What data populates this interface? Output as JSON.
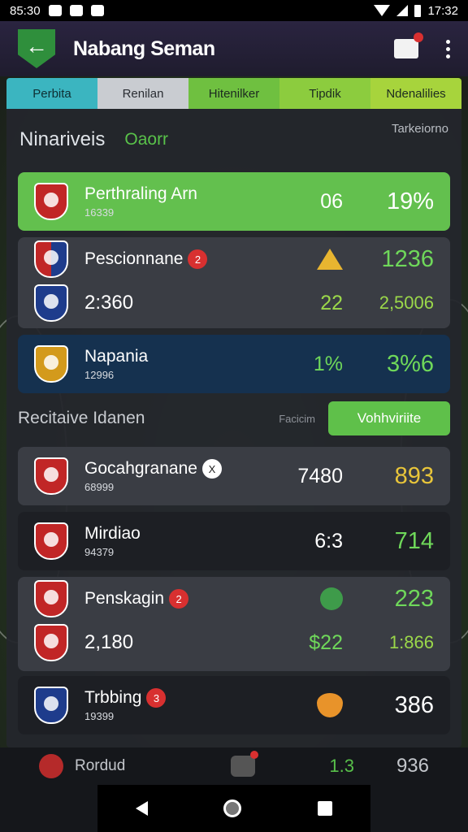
{
  "status_bar": {
    "time_left": "85:30",
    "time_right": "17:32"
  },
  "app_bar": {
    "title": "Nabang Seman"
  },
  "tabs": [
    "Perbita",
    "Renilan",
    "Hitenilker",
    "Tipdik",
    "Ndenalilies"
  ],
  "section1": {
    "title": "Ninariveis",
    "subtitle": "Oaorr",
    "right_label": "Tarkeiorno"
  },
  "rows_top": [
    {
      "name": "Perthraling Arn",
      "code": "16339",
      "v1": "06",
      "v2": "19%"
    },
    {
      "name": "Pescionnane",
      "badge": "2",
      "score": "2:360",
      "v1a": "",
      "v2a": "1236",
      "v1b": "22",
      "v2b": "2,5006"
    },
    {
      "name": "Napania",
      "code": "12996",
      "v1": "1%",
      "v2": "3%6"
    }
  ],
  "section2": {
    "title": "Recitaive Idanen",
    "small": "Facicim",
    "button": "Vohhviriite"
  },
  "rows_bottom": [
    {
      "name": "Gocahgranane",
      "badge": "X",
      "code": "68999",
      "v1": "7480",
      "v2": "893"
    },
    {
      "name": "Mirdiao",
      "code": "94379",
      "v1": "6:3",
      "v2": "714"
    },
    {
      "name": "Penskagin",
      "badge": "2",
      "score": "2,180",
      "v2a": "223",
      "v1b": "$22",
      "v2b": "1:866"
    },
    {
      "name": "Trbbing",
      "badge": "3",
      "code": "19399",
      "v2": "386"
    }
  ],
  "bottom_row": {
    "name": "Rordud",
    "v1": "1.3",
    "v2": "936"
  },
  "colors": {
    "accent_green": "#63c04e",
    "navy": "#15314f",
    "yellow": "#e8c53a"
  }
}
